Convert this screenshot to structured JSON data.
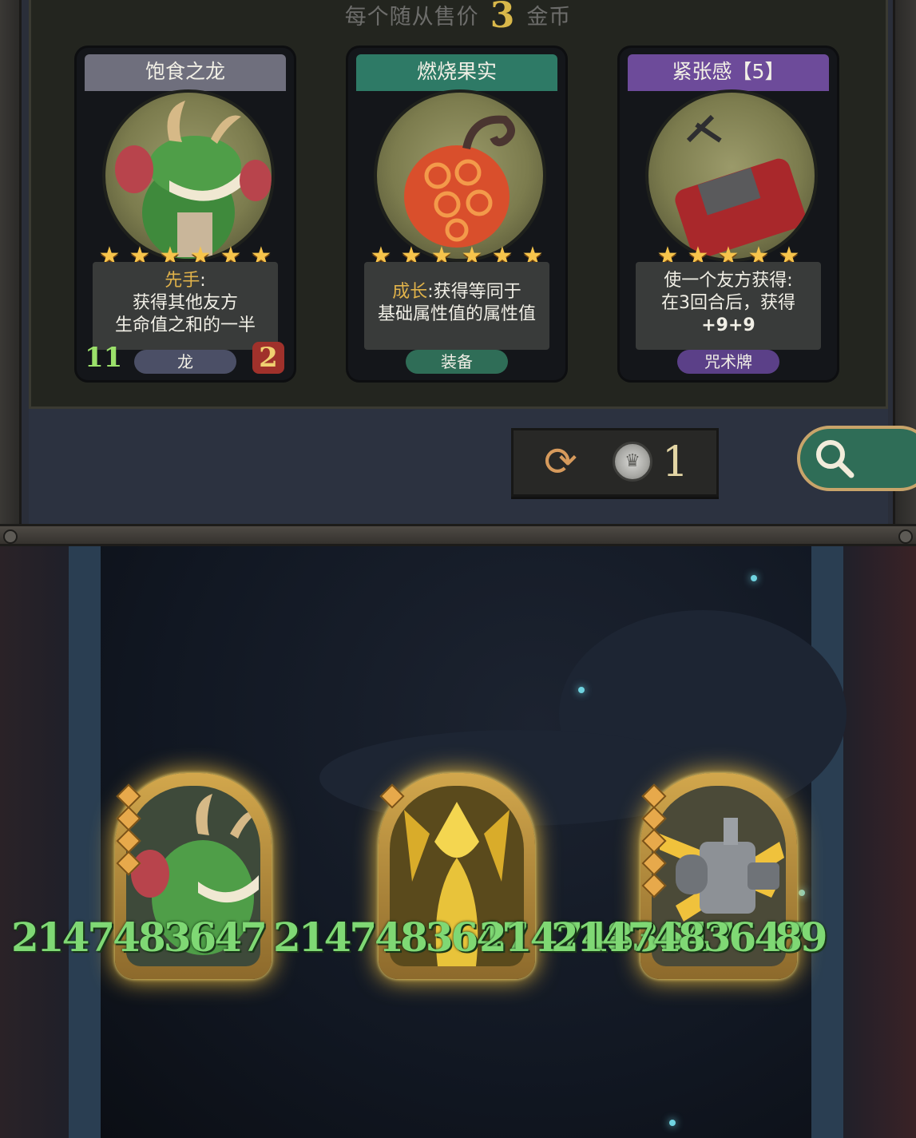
{
  "shop": {
    "price_prefix": "每个随从售价",
    "price_value": "3",
    "price_suffix": "金币",
    "cards": [
      {
        "name": "饱食之龙",
        "stars": 6,
        "keyword": "先手",
        "desc_after_keyword": ":",
        "desc_line2": "获得其他友方",
        "desc_line3": "生命值之和的一半",
        "tag": "龙",
        "attack": "11",
        "health": "2",
        "theme_color": "#6f6f7d"
      },
      {
        "name": "燃烧果实",
        "stars": 6,
        "keyword": "成长",
        "desc_after_keyword": ":获得等同于",
        "desc_line2": "基础属性值的属性值",
        "tag": "装备",
        "theme_color": "#2e7a66"
      },
      {
        "name": "紧张感【5】",
        "stars": 5,
        "desc_line1": "使一个友方获得:",
        "desc_line2": "在3回合后，获得",
        "desc_line3": "+9+9",
        "tag": "咒术牌",
        "theme_color": "#6d4b9a"
      }
    ],
    "reroll_cost": "1"
  },
  "board": {
    "overflow_numbers": [
      "2147483647",
      "2147483647",
      "2147483647",
      "2147483647",
      "89"
    ],
    "minions": [
      {
        "name": "dragon-minion",
        "gem_count": 4
      },
      {
        "name": "golden-dragon-minion",
        "gem_count": 1
      },
      {
        "name": "robot-minion",
        "gem_count": 5
      }
    ]
  },
  "colors": {
    "gold": "#d9b84a",
    "keyword": "#e0b24a",
    "overflow_text": "#7fd874",
    "glow": "#f2c040"
  },
  "icons": {
    "reroll": "refresh-icon",
    "coin": "crown-coin-icon",
    "search": "search-icon",
    "star": "star-icon"
  }
}
